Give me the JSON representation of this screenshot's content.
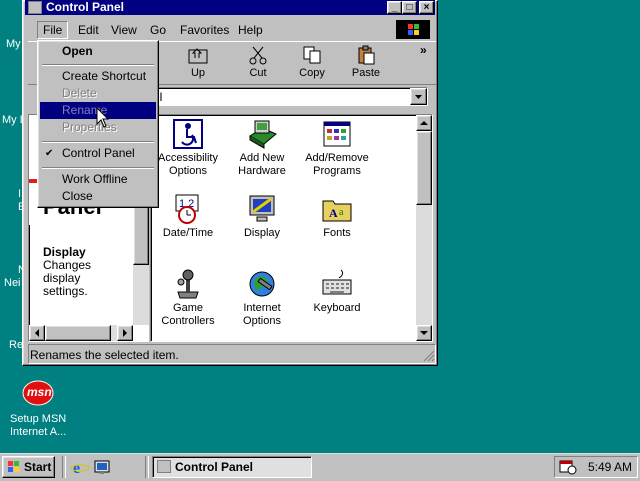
{
  "desktop": {
    "partial_labels": [
      "My",
      "My D",
      "I",
      "E",
      "N",
      "Nei",
      "Re"
    ],
    "setup_msn": {
      "line1": "Setup MSN",
      "line2": "Internet A...",
      "logo": "msn"
    }
  },
  "window": {
    "title": "Control Panel",
    "controls": {
      "minimize": "_",
      "maximize": "□",
      "close": "×"
    },
    "menubar": [
      "File",
      "Edit",
      "View",
      "Go",
      "Favorites",
      "Help"
    ],
    "toolbar": {
      "more": "»",
      "buttons": [
        "Up",
        "Cut",
        "Copy",
        "Paste"
      ]
    },
    "address": {
      "value": "el"
    },
    "left_pane": {
      "heading_partial": "Panel",
      "selected_title": "Display",
      "selected_desc_lines": [
        "Changes",
        "display",
        "settings."
      ]
    },
    "items": [
      {
        "line1": "Accessibility",
        "line2": "Options",
        "icon": "accessibility-icon"
      },
      {
        "line1": "Add New",
        "line2": "Hardware",
        "icon": "add-hardware-icon"
      },
      {
        "line1": "Add/Remove",
        "line2": "Programs",
        "icon": "add-remove-programs-icon"
      },
      {
        "line1": "Date/Time",
        "line2": "",
        "icon": "date-time-icon"
      },
      {
        "line1": "Display",
        "line2": "",
        "icon": "display-icon"
      },
      {
        "line1": "Fonts",
        "line2": "",
        "icon": "fonts-icon"
      },
      {
        "line1": "Game",
        "line2": "Controllers",
        "icon": "game-controllers-icon"
      },
      {
        "line1": "Internet",
        "line2": "Options",
        "icon": "internet-options-icon"
      },
      {
        "line1": "Keyboard",
        "line2": "",
        "icon": "keyboard-icon"
      }
    ],
    "status_text": "Renames the selected item."
  },
  "file_menu": {
    "open": "Open",
    "create_shortcut": "Create Shortcut",
    "delete": "Delete",
    "rename": "Rename",
    "properties": "Properties",
    "control_panel": "Control Panel",
    "control_panel_check": "✔",
    "work_offline": "Work Offline",
    "close": "Close",
    "highlighted": "Rename"
  },
  "taskbar": {
    "start": "Start",
    "task_button": "Control Panel",
    "clock": "5:49 AM"
  },
  "colors": {
    "desktop": "#008080",
    "title_active": "#000080",
    "face": "#c0c0c0",
    "highlight": "#000080"
  }
}
